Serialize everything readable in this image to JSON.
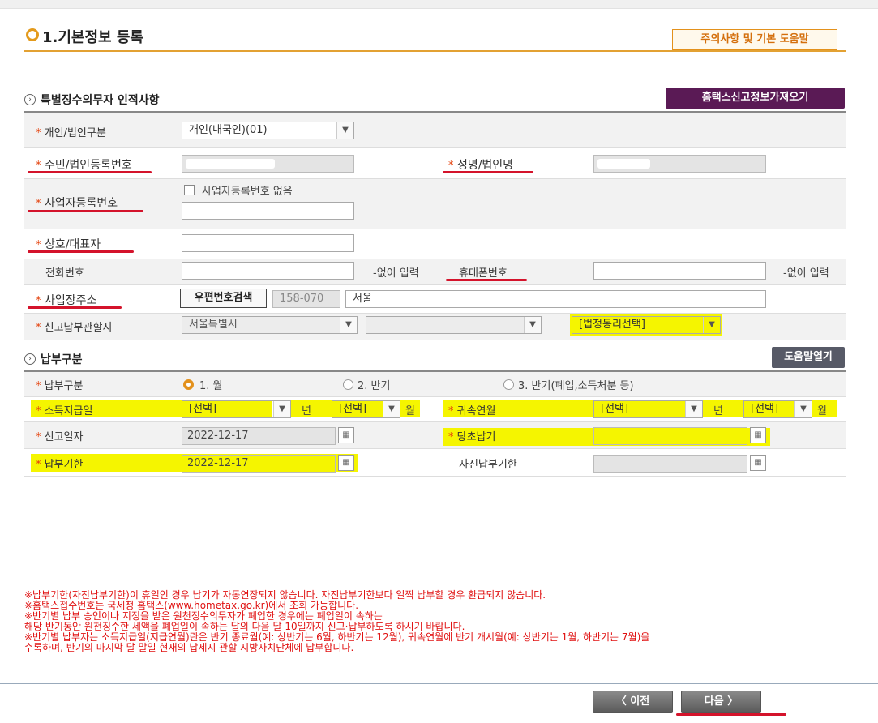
{
  "header": {
    "title": "1.기본정보 등록",
    "help_button": "주의사항 및 기본 도움말"
  },
  "section1": {
    "title": "특별징수의무자 인적사항",
    "import_button": "홈택스신고정보가져오기",
    "rows": {
      "type_label": "개인/법인구분",
      "type_value": "개인(내국인)(01)",
      "regno_label": "주민/법인등록번호",
      "name_label": "성명/법인명",
      "bizno_label": "사업자등록번호",
      "no_bizno_label": "사업자등록번호 없음",
      "company_label": "상호/대표자",
      "phone_label": "전화번호",
      "phone_hint": "-없이 입력",
      "mobile_label": "휴대폰번호",
      "mobile_hint": "-없이 입력",
      "address_label": "사업장주소",
      "zip_button": "우편번호검색",
      "zip_value": "158-070",
      "address_value": "서울",
      "tax_office_label": "신고납부관할지",
      "city_value": "서울특별시",
      "dong_value": "[법정동리선택]"
    }
  },
  "section2": {
    "title": "납부구분",
    "help_button": "도움말열기",
    "rows": {
      "payment_type_label": "납부구분",
      "option1": "1. 월",
      "option2": "2. 반기",
      "option3": "3. 반기(폐업,소득처분 등)",
      "income_date_label": "소득지급일",
      "select_placeholder": "[선택]",
      "year_unit": "년",
      "month_unit": "월",
      "attrib_label": "귀속연월",
      "report_date_label": "신고일자",
      "report_date_value": "2022-12-17",
      "initial_label": "당초납기",
      "due_date_label": "납부기한",
      "due_date_value": "2022-12-17",
      "self_due_label": "자진납부기한"
    }
  },
  "notes": [
    "※납부기한(자진납부기한)이 휴일인 경우 납기가 자동연장되지 않습니다. 자진납부기한보다 일찍 납부할 경우 환급되지 않습니다.",
    "※홈택스접수번호는 국세청 홈택스(www.hometax.go.kr)에서 조회 가능합니다.",
    "※반기별 납부 승인이나 지정을 받은 원천징수의무자가 폐업한 경우에는 폐업일이 속하는",
    "   해당 반기동안 원천징수한 세액을 폐업일이 속하는 달의 다음 달 10일까지 신고·납부하도록 하시기 바랍니다.",
    "※반기별 납부자는 소득지급일(지급연월)란은 반기 종료월(예: 상반기는 6월, 하반기는 12월), 귀속연월에 반기 개시월(예: 상반기는 1월, 하반기는 7월)을",
    "   수록하며, 반기의 마지막 달 말일 현재의 납세지 관할 지방자치단체에 납부합니다."
  ],
  "footer": {
    "prev_button": "〈 이전",
    "next_button": "다음 〉"
  },
  "colors": {
    "accent_orange": "#e3911c",
    "purple_button": "#5a1a55",
    "required_star": "#e4400b",
    "highlight": "#f5f500",
    "annotation_red": "#d4132b"
  },
  "star": "*"
}
